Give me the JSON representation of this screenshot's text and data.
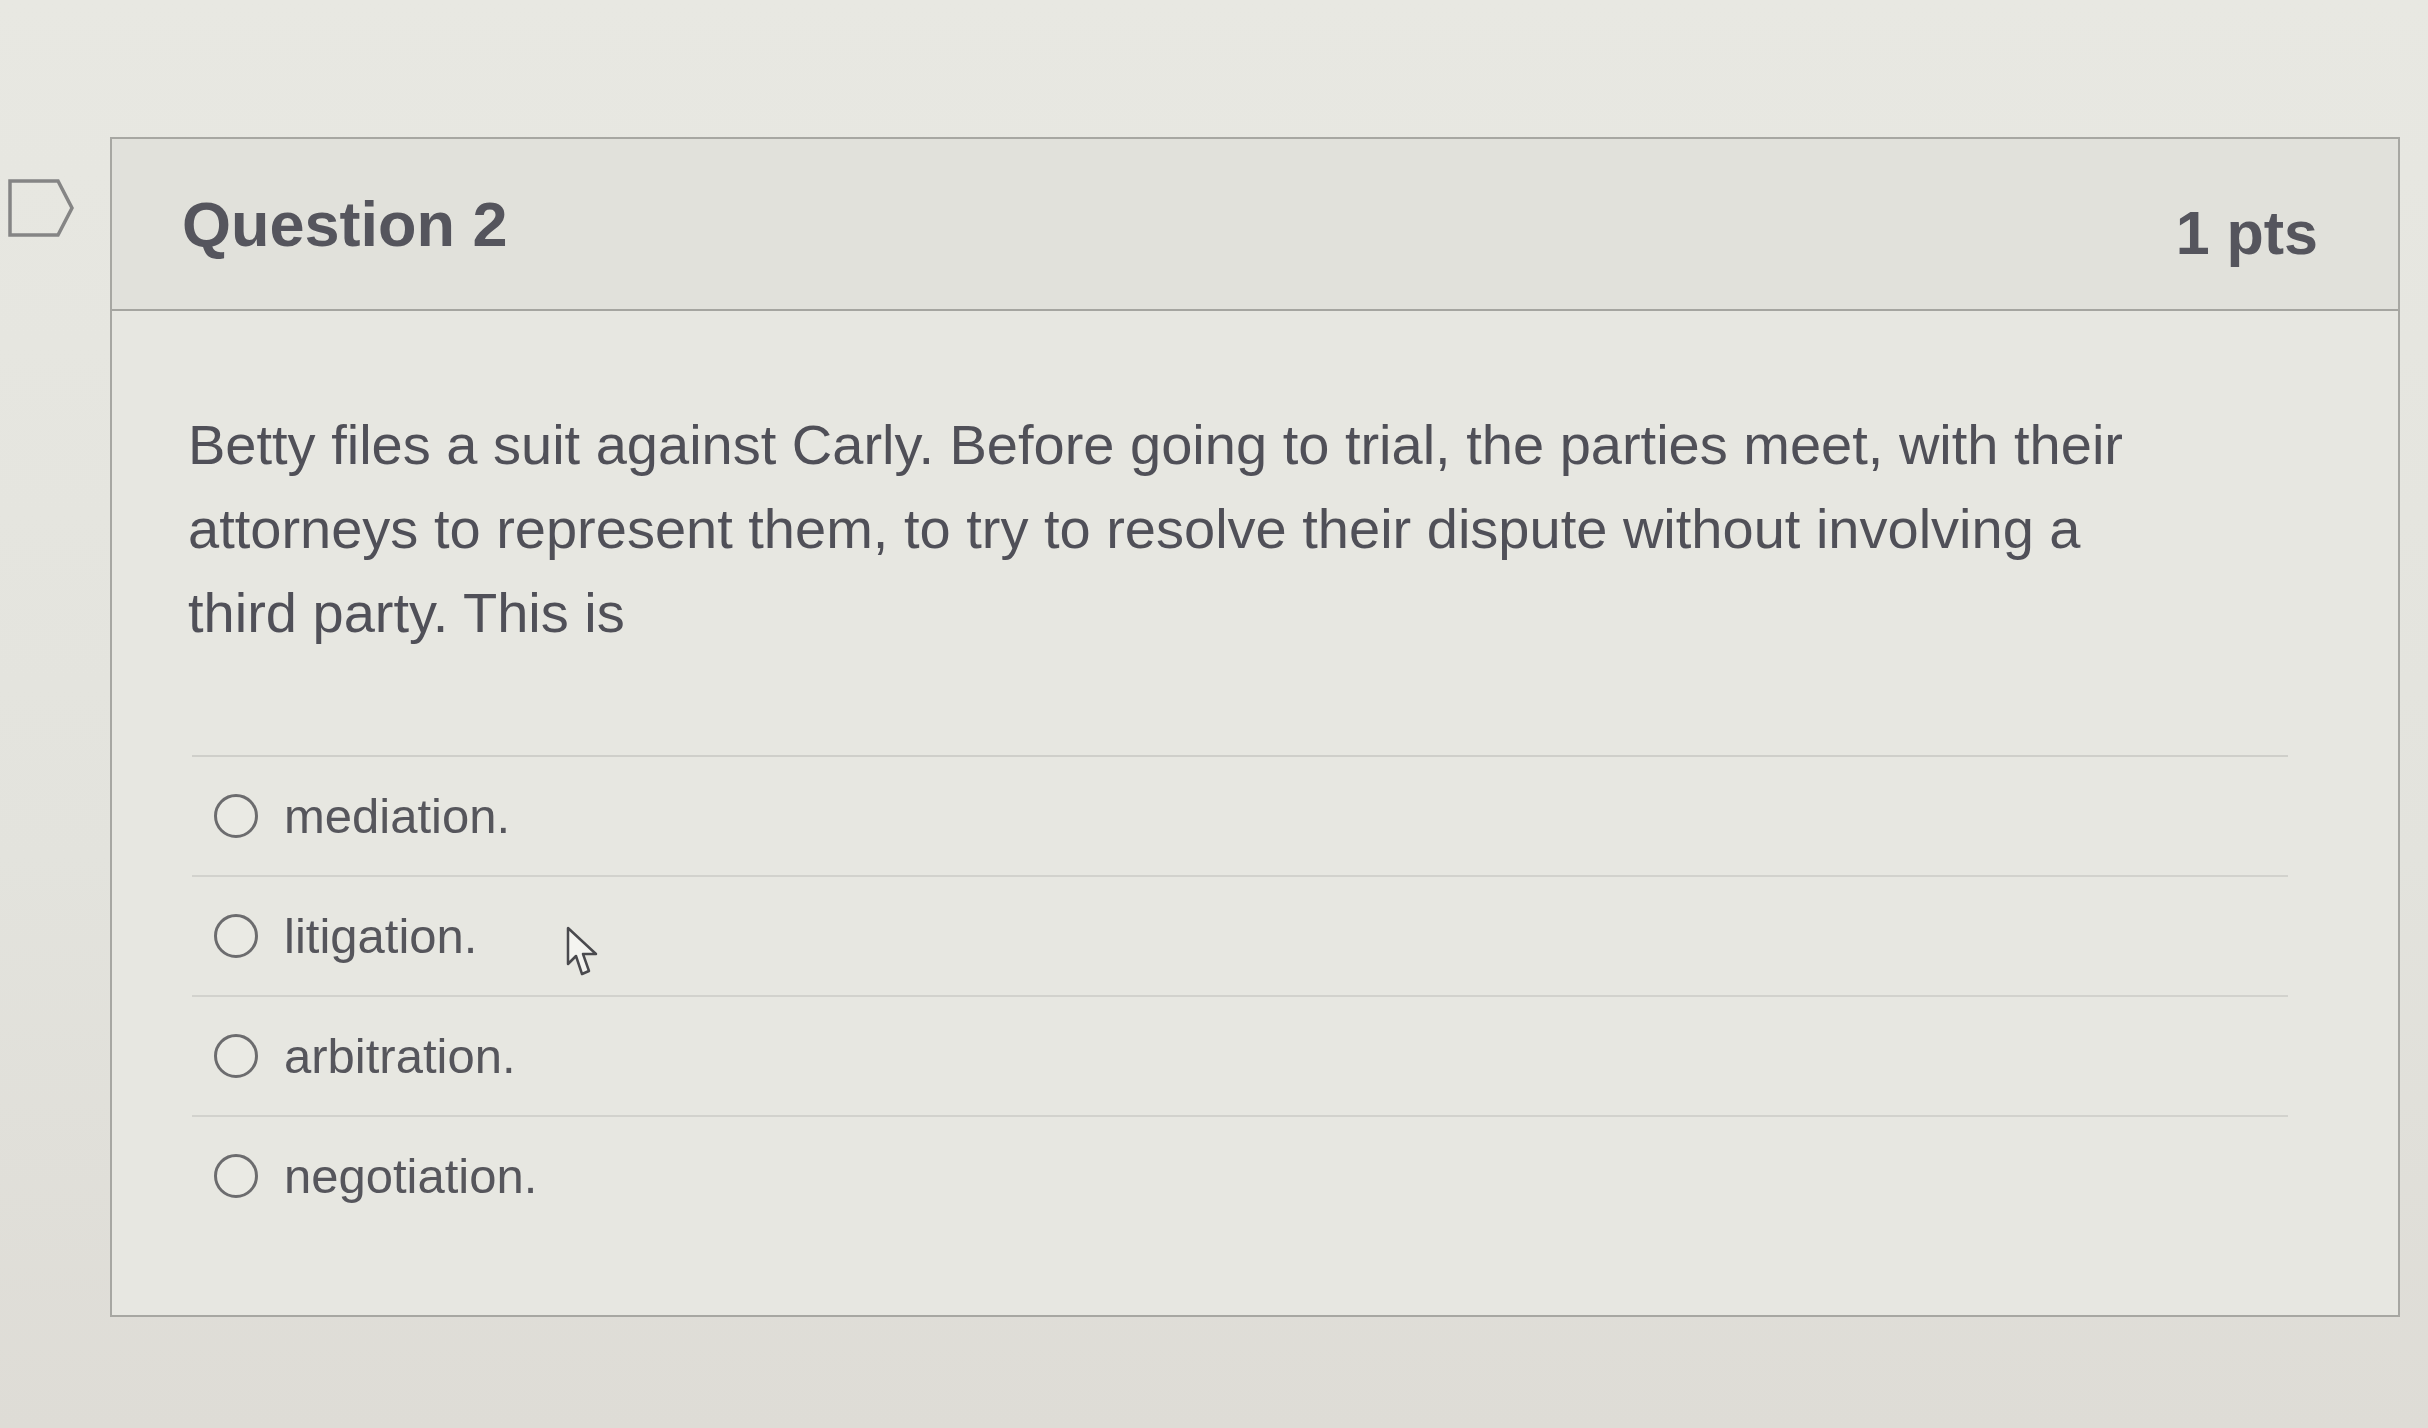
{
  "question": {
    "flagged": false,
    "title": "Question 2",
    "points": "1 pts",
    "text": "Betty files a suit against Carly. Before going to trial, the parties meet, with their attorneys to represent them, to try to resolve their dispute without involving a third party. This is",
    "answers": [
      {
        "label": "mediation.",
        "selected": false
      },
      {
        "label": "litigation.",
        "selected": false
      },
      {
        "label": "arbitration.",
        "selected": false
      },
      {
        "label": "negotiation.",
        "selected": false
      }
    ]
  }
}
